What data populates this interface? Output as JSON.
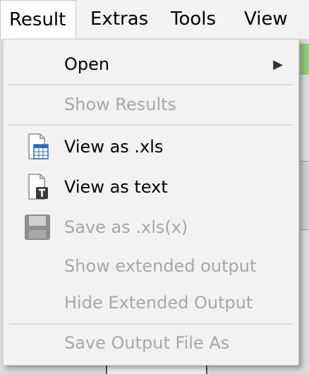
{
  "menubar": {
    "items": [
      {
        "label": "Result",
        "active": true
      },
      {
        "label": "Extras",
        "active": false
      },
      {
        "label": "Tools",
        "active": false
      },
      {
        "label": "View",
        "active": false
      }
    ]
  },
  "menu": {
    "open": {
      "label": "Open",
      "enabled": true,
      "submenu_icon": "chevron-right-icon"
    },
    "show_results": {
      "label": "Show Results",
      "enabled": false
    },
    "view_xls": {
      "label": "View as .xls",
      "enabled": true,
      "icon": "spreadsheet-icon"
    },
    "view_text": {
      "label": "View as text",
      "enabled": true,
      "icon": "text-document-icon"
    },
    "save_xls": {
      "label": "Save as .xls(x)",
      "enabled": false,
      "icon": "save-icon"
    },
    "show_extended": {
      "label": "Show extended output",
      "enabled": false
    },
    "hide_extended": {
      "label": "Hide Extended Output",
      "enabled": false
    },
    "save_output": {
      "label": "Save Output File As",
      "enabled": false
    }
  },
  "colors": {
    "enabled_text": "#000000",
    "disabled_text": "#a7a7a7",
    "menu_background": "#f2f2f2",
    "spreadsheet_blue": "#2f6db5"
  }
}
